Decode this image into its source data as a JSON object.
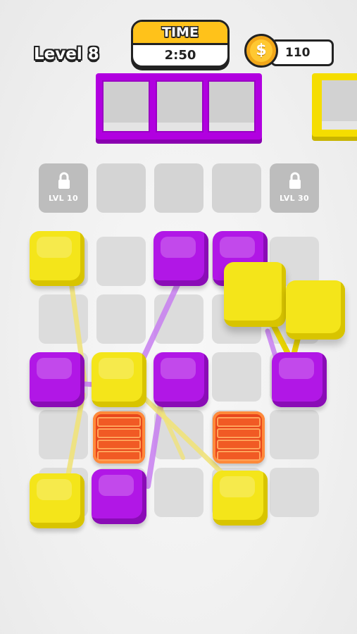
{
  "header": {
    "level_label": "Level 8",
    "timer_title": "TIME",
    "timer_value": "2:50",
    "coins": "110",
    "coin_symbol": "$"
  },
  "trays": {
    "active_color": "purple",
    "active_slots": 3,
    "next_color": "yellow"
  },
  "locked_tiles": [
    {
      "label": "LVL 10"
    },
    {
      "label": "LVL 30"
    }
  ],
  "colors": {
    "yellow": "#f4e51a",
    "purple": "#b117e6",
    "brick": "#e8461c",
    "tile": "#dcdcdc"
  }
}
